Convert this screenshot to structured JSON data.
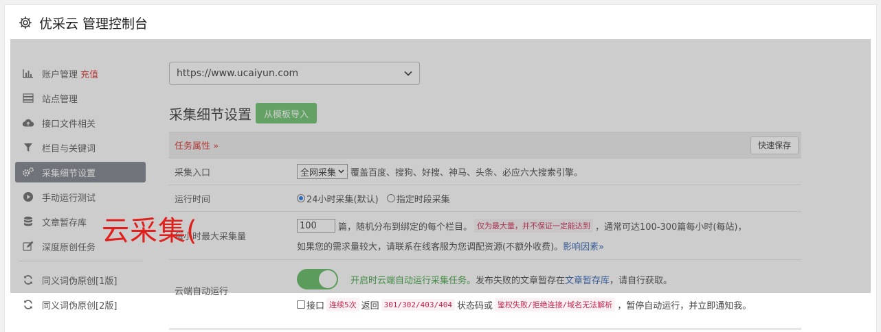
{
  "header": {
    "title": "优采云 管理控制台",
    "icon": "gear-icon"
  },
  "sidebar": {
    "items": [
      {
        "label": "账户管理",
        "badge": "充值",
        "icon": "bar-chart-icon"
      },
      {
        "label": "站点管理",
        "icon": "server-icon"
      },
      {
        "label": "接口文件相关",
        "icon": "cloud-upload-icon"
      },
      {
        "label": "栏目与关键词",
        "icon": "filter-icon"
      },
      {
        "label": "采集细节设置",
        "icon": "gears-icon",
        "active": true
      },
      {
        "label": "手动运行测试",
        "icon": "play-circle-icon"
      },
      {
        "label": "文章暂存库",
        "icon": "database-icon"
      },
      {
        "label": "深度原创任务",
        "icon": "edit-icon"
      }
    ],
    "items2": [
      {
        "label": "同义词伪原创[1版]",
        "icon": "refresh-icon"
      },
      {
        "label": "同义词伪原创[2版]",
        "icon": "refresh-icon"
      }
    ]
  },
  "main": {
    "site_select_value": "https://www.ucaiyun.com",
    "heading": "采集细节设置",
    "import_button": "从模板导入",
    "task_section_label": "任务属性 »",
    "quick_save": "快速保存",
    "rows": {
      "entry": {
        "label": "采集入口",
        "select_value": "全网采集",
        "desc": "覆盖百度、搜狗、好搜、神马、头条、必应六大搜索引擎。"
      },
      "runtime": {
        "label": "运行时间",
        "option1": "24小时采集(默认)",
        "option2": "指定时段采集"
      },
      "max_per_hour": {
        "label": "每小时最大采集量",
        "value": "100",
        "text1": "篇，随机分布到绑定的每个栏目。",
        "code1": "仅为最大量，并不保证一定能达到",
        "text2": "，通常可达100-300篇每小时(每站)，",
        "line2": "如果您的需求量较大，请联系在线客服为您调配资源(不额外收费)。",
        "link": "影响因素»"
      },
      "cloud_run": {
        "label": "云端自动运行",
        "toggle_on": true,
        "green_text": "开启时云端自动运行采集任务。",
        "text1": "发布失败的文章暂存在",
        "link": "文章暂存库",
        "text2": "，请自行获取。",
        "cb_text1": "接口",
        "code1": "连续5次",
        "cb_text2": "返回",
        "code2": "301/302/403/404",
        "cb_text3": "状态码或",
        "code3": "鉴权失败/拒绝连接/域名无法解析",
        "cb_text4": "，暂停自动运行，并立即通知我。"
      }
    }
  },
  "watermark": "云采集(",
  "colors": {
    "accent_red": "#d9302c",
    "green": "#67c16a",
    "active_bg": "#7a7f87",
    "link": "#2a5db0"
  }
}
